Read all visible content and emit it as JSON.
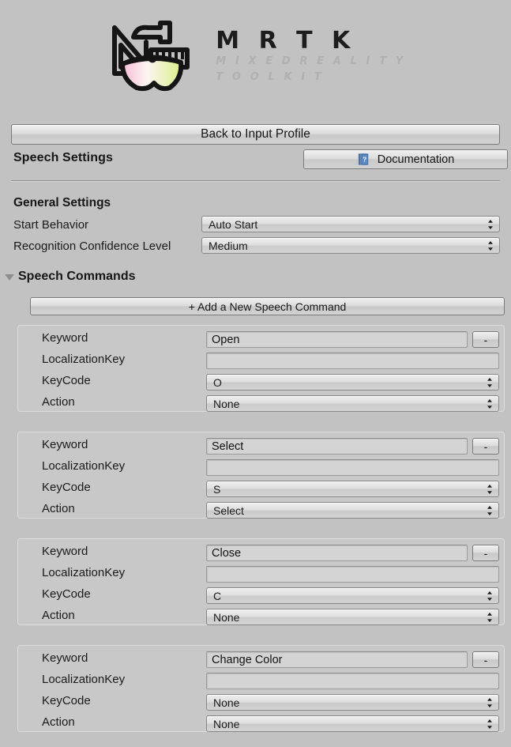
{
  "header": {
    "brand": "M R T K",
    "tagline_line1": "M I X E D   R E A L I T Y",
    "tagline_line2": "T O O L K I T",
    "logo_icon": "mrtk-logo-icon"
  },
  "toolbar": {
    "back_label": "Back to Input Profile",
    "documentation_label": "Documentation",
    "documentation_icon": "help-book-icon"
  },
  "sections": {
    "speech_settings_title": "Speech Settings",
    "general_settings_title": "General Settings",
    "speech_commands_title": "Speech Commands",
    "foldout_icon": "triangle-down-icon"
  },
  "general": {
    "start_behavior_label": "Start Behavior",
    "start_behavior_value": "Auto Start",
    "confidence_label": "Recognition Confidence Level",
    "confidence_value": "Medium",
    "dropdown_icon": "updown-arrows-icon"
  },
  "commands": {
    "add_label": "+ Add a New Speech Command",
    "remove_label": "-",
    "field_labels": {
      "keyword": "Keyword",
      "localization_key": "LocalizationKey",
      "keycode": "KeyCode",
      "action": "Action"
    },
    "placeholder": "",
    "items": [
      {
        "keyword": "Open",
        "localization_key": "",
        "keycode": "O",
        "action": "None"
      },
      {
        "keyword": "Select",
        "localization_key": "",
        "keycode": "S",
        "action": "Select"
      },
      {
        "keyword": "Close",
        "localization_key": "",
        "keycode": "C",
        "action": "None"
      },
      {
        "keyword": "Change Color",
        "localization_key": "",
        "keycode": "None",
        "action": "None"
      }
    ]
  },
  "colors": {
    "window_background": "#c2c2c2",
    "panel_background": "#c8c8c8",
    "panel_border": "#dcdcdc",
    "text": "#1a1a1a",
    "tagline": "#b0b0b0",
    "foldout_arrow": "#8f8f8f",
    "doc_icon_blue": "#4a7fbf"
  }
}
